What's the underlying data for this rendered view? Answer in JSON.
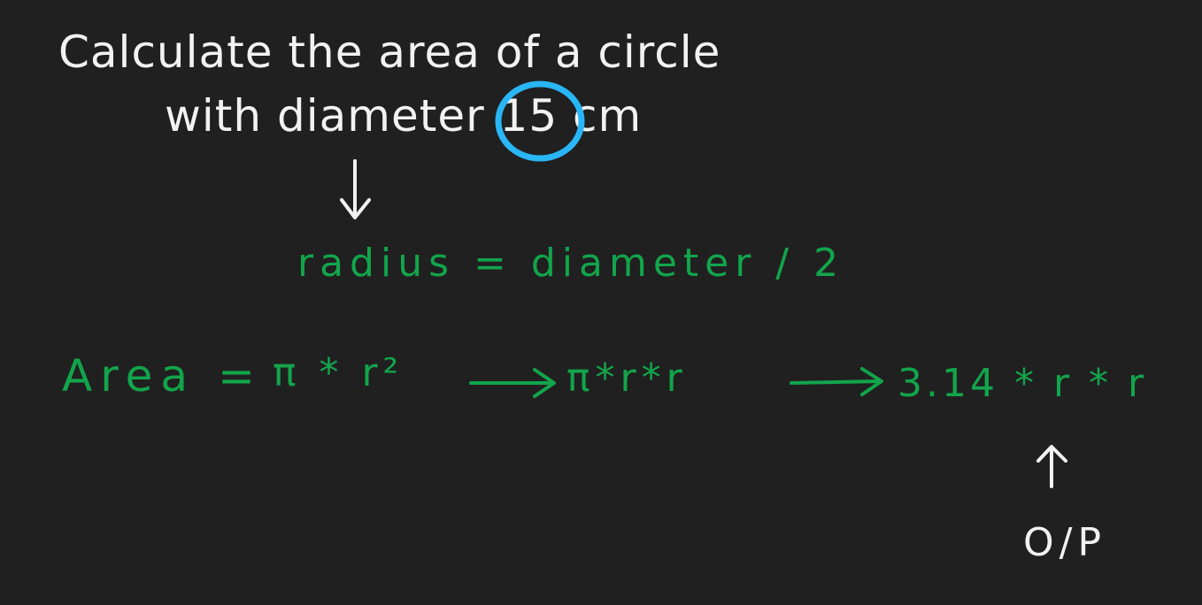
{
  "question": {
    "line1": "Calculate the area of a circle",
    "line2": "with diameter 15 cm",
    "highlighted_value": "15"
  },
  "radius_formula": "radius = diameter / 2",
  "area_formula": {
    "label": "Area =",
    "step1": "π * r²",
    "step2": "π*r*r",
    "step3": "3.14 * r * r"
  },
  "output_label": "O/P",
  "colors": {
    "background": "#202020",
    "question_text": "#f2f2f2",
    "formula_text": "#12a54b",
    "highlight_circle": "#29b6f6",
    "output_text": "#f2f2f2"
  }
}
